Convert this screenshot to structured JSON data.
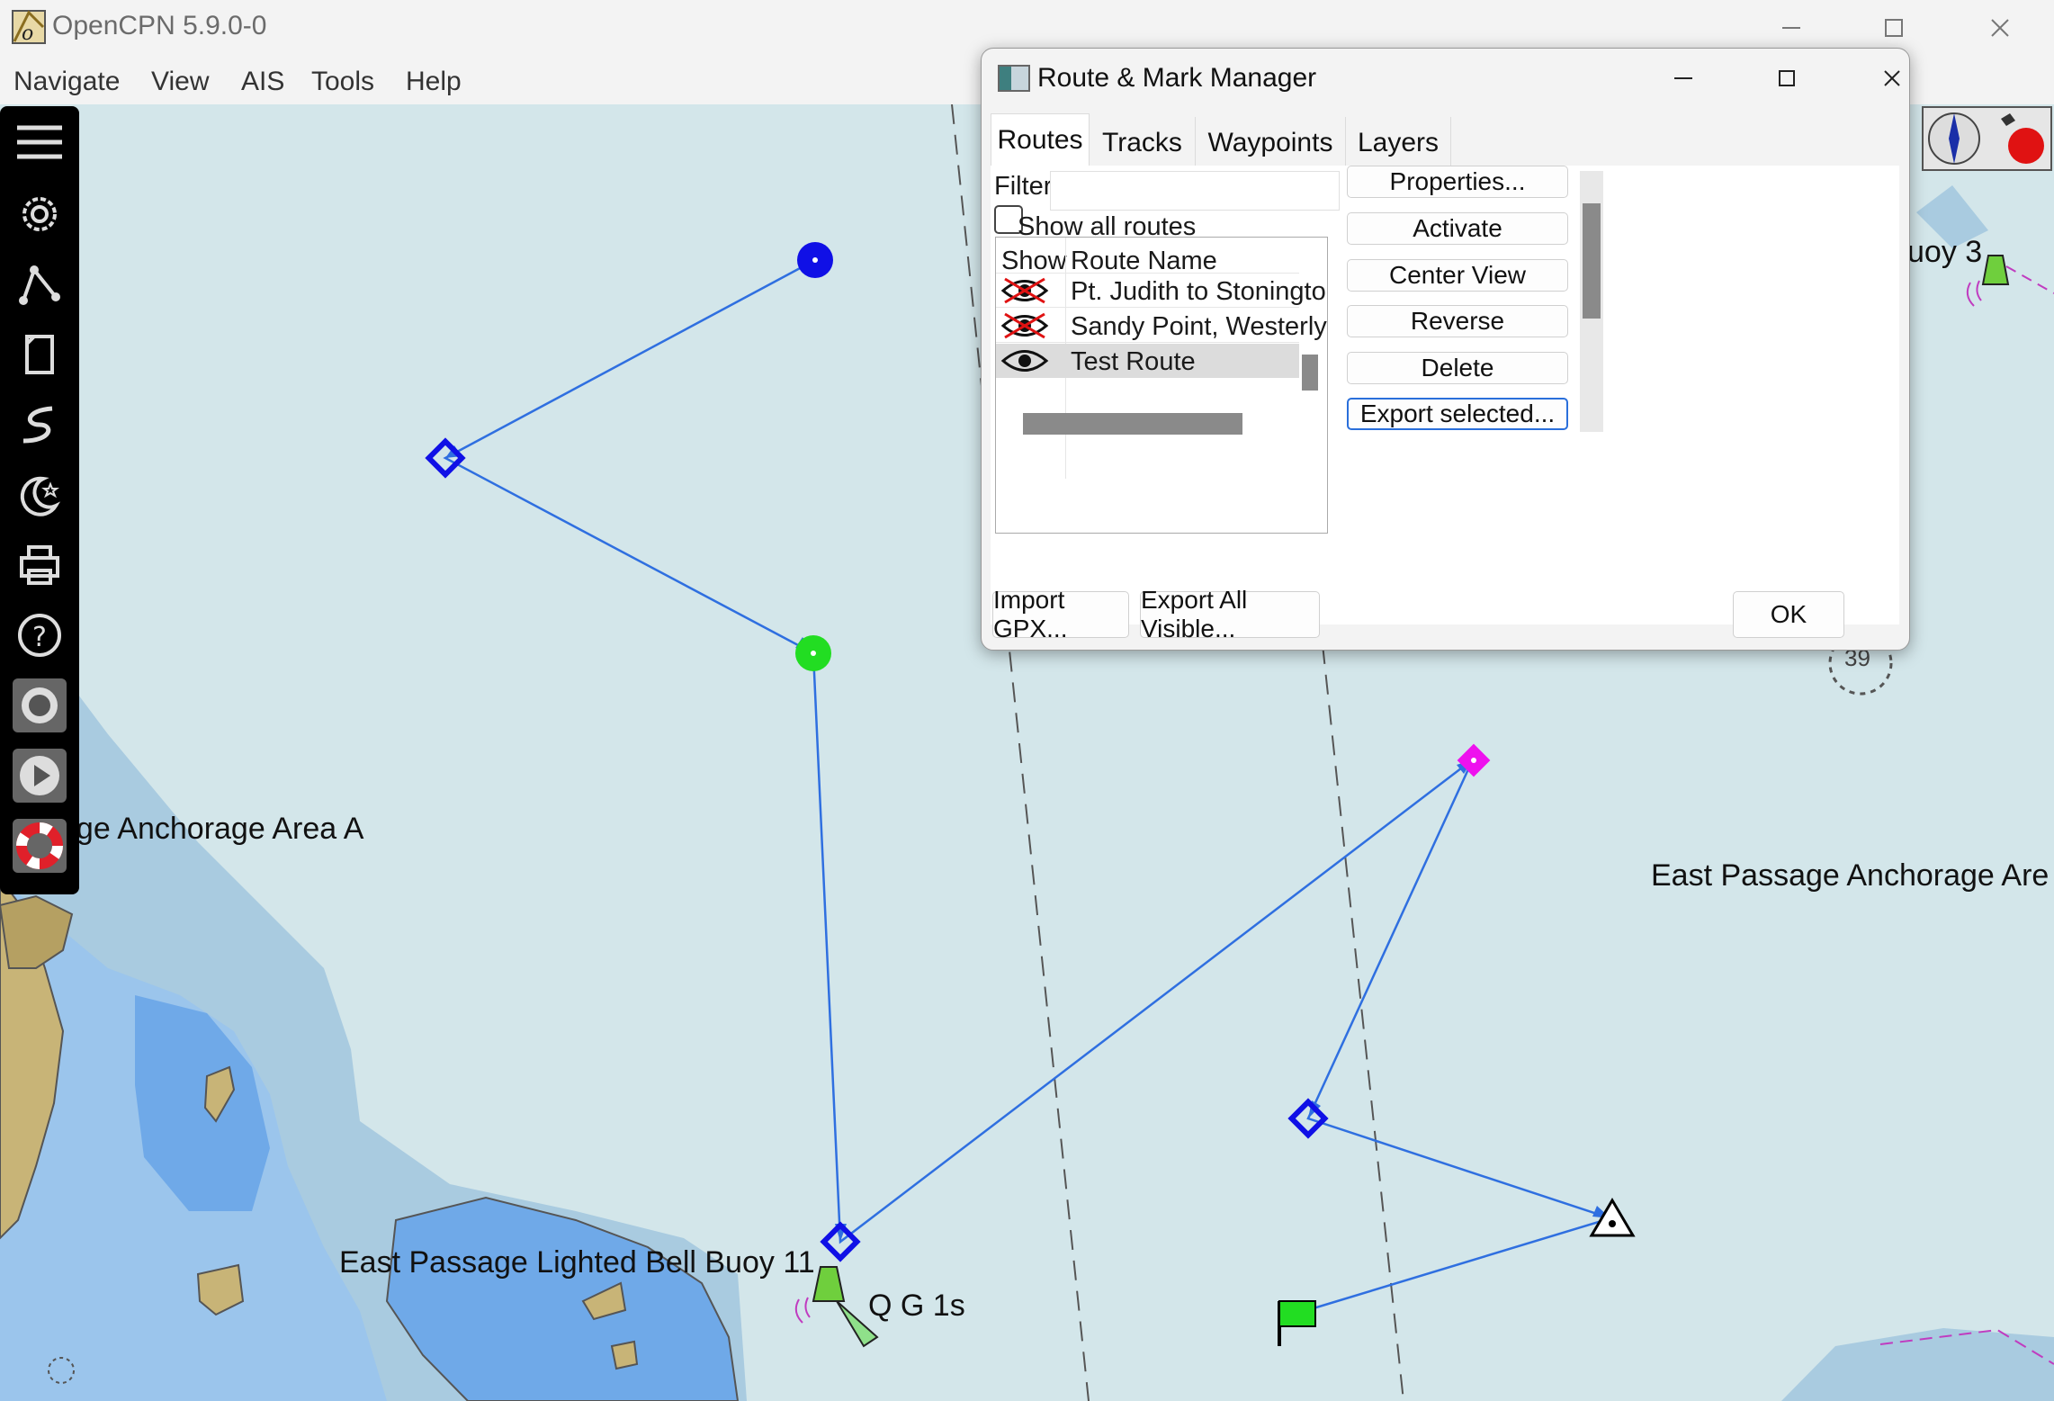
{
  "window": {
    "title": "OpenCPN 5.9.0-0"
  },
  "menu": [
    "Navigate",
    "View",
    "AIS",
    "Tools",
    "Help"
  ],
  "chart": {
    "labels": {
      "anchorage_left": "age Anchorage Area A",
      "anchorage_right": "East Passage Anchorage Are",
      "buoy11": "East Passage Lighted Bell Buoy 11",
      "light": "Q G 1s",
      "buoy3": "uoy 3",
      "depth": "39"
    }
  },
  "toolbar": {
    "icons": [
      "menu-icon",
      "settings-gear-icon",
      "route-icon",
      "route-manager-icon",
      "track-icon",
      "night-mode-icon",
      "print-icon",
      "help-icon",
      "record-icon",
      "play-icon",
      "mob-lifebuoy-icon"
    ]
  },
  "dialog": {
    "title": "Route & Mark Manager",
    "tabs": [
      "Routes",
      "Tracks",
      "Waypoints",
      "Layers"
    ],
    "filter_label": "Filter",
    "filter_value": "",
    "show_all_label": "Show all routes",
    "show_all_checked": false,
    "columns": [
      "Show",
      "Route Name"
    ],
    "routes": [
      {
        "name": "Pt. Judith to Stonington  Aug",
        "visible": false,
        "selected": false
      },
      {
        "name": "Sandy Point, Westerly RI",
        "visible": false,
        "selected": false
      },
      {
        "name": "Test Route",
        "visible": true,
        "selected": true
      }
    ],
    "buttons": {
      "properties": "Properties...",
      "activate": "Activate",
      "center_view": "Center View",
      "reverse": "Reverse",
      "delete": "Delete",
      "export_selected": "Export selected...",
      "import_gpx": "Import GPX...",
      "export_all": "Export All Visible...",
      "ok": "OK"
    }
  },
  "colors": {
    "sea": "#d3e6ea",
    "shallow": "#9bc5ec",
    "very_shallow": "#6fa9e8",
    "land": "#c8b477",
    "route": "#2f6fe0",
    "focus": "#2a6fdb"
  }
}
